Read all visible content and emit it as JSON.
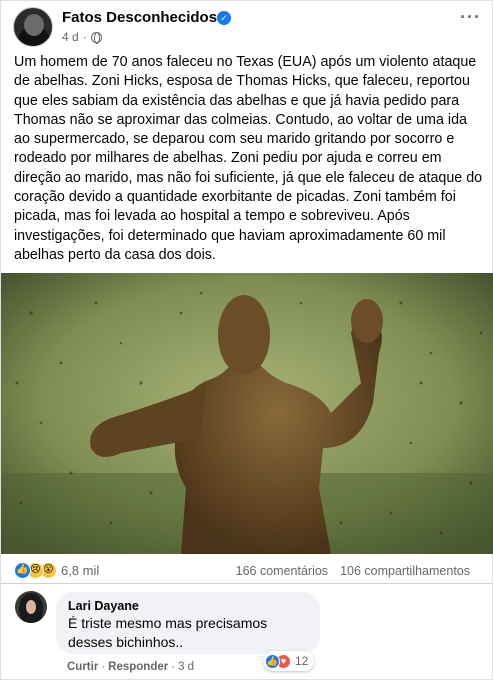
{
  "post": {
    "page_name": "Fatos Desconhecidos",
    "time": "4 d",
    "text": "Um homem de 70 anos faleceu no Texas (EUA) após um violento ataque de abelhas. Zoni Hicks, esposa de Thomas Hicks, que faleceu, reportou que eles sabiam da existência das abelhas e que já havia pedido para Thomas não se aproximar das colmeias. Contudo, ao voltar de uma ida ao supermercado, se deparou com seu marido gritando por socorro e rodeado por milhares de abelhas. Zoni pediu por ajuda e correu em direção ao marido, mas não foi suficiente, já que ele faleceu de ataque do coração devido a quantidade exorbitante de picadas. Zoni também foi picada, mas foi levada ao hospital a tempo e sobreviveu. Após investigações, foi determinado que haviam aproximadamente 60 mil abelhas perto da casa dos dois."
  },
  "stats": {
    "reactions_count": "6,8 mil",
    "comments": "166 comentários",
    "shares": "106 compartilhamentos",
    "reaction_icons": [
      "like-icon",
      "sad-icon",
      "wow-icon"
    ]
  },
  "comment": {
    "author": "Lari Dayane",
    "text_line1": "É triste mesmo mas precisamos",
    "text_line2": "desses bichinhos..",
    "like_label": "Curtir",
    "reply_label": "Responder",
    "time": "3 d",
    "reactions_count": "12",
    "reaction_icons": [
      "like-icon",
      "love-icon"
    ],
    "separator": "·"
  },
  "colors": {
    "brand_blue": "#1877f2",
    "secondary_text": "#65676b",
    "bubble_bg": "#f0f2f5"
  }
}
